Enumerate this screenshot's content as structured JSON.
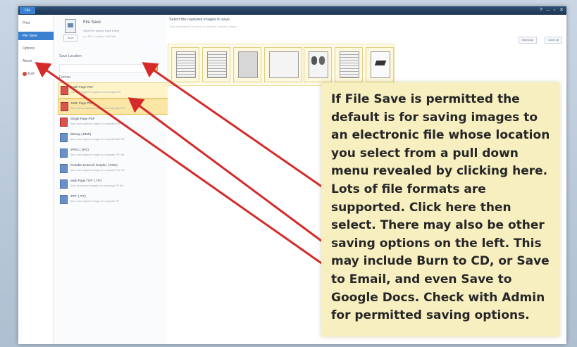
{
  "window": {
    "file_tab": "File",
    "controls": [
      "?",
      "–",
      "▫",
      "✕"
    ]
  },
  "left_nav": {
    "items": [
      {
        "label": "Print",
        "active": false
      },
      {
        "label": "File Save",
        "active": true
      },
      {
        "label": "Options",
        "active": false
      },
      {
        "label": "About",
        "active": false
      },
      {
        "label": "Exit",
        "active": false
      }
    ]
  },
  "save_panel": {
    "title": "File Save",
    "button_label": "Save",
    "subtitle": "Save Per source   Save Every",
    "subtitle2": "on: File Location: FilePath",
    "save_location_heading": "Save Location",
    "location_placeholder": "",
    "format_heading": "Format",
    "formats": [
      {
        "name": "Multi Page PDF",
        "desc": "Save all captured images to a multi page PDF",
        "icon": "pdf-icon",
        "state": "hl2"
      },
      {
        "name": "Multi Page PDF",
        "desc": "Save all the captured images to a multi page PDF",
        "icon": "pdf-icon",
        "state": "hl"
      },
      {
        "name": "Single Page PDF",
        "desc": "Save each captured image to a separate PDF",
        "icon": "pdf-icon",
        "state": ""
      },
      {
        "name": "Bitmap (.BMP)",
        "desc": "Save each captured image to a separate BMP file",
        "icon": "image-icon",
        "state": ""
      },
      {
        "name": "JPEG (.JPG)",
        "desc": "Save each captured image to a separate JPG file",
        "icon": "image-icon",
        "state": ""
      },
      {
        "name": "Portable Network Graphic (.PNG)",
        "desc": "Save each captured image to a separate PNG file",
        "icon": "image-icon",
        "state": ""
      },
      {
        "name": "Multi Page TIFF (.TIF)",
        "desc": "Save all captured images to a multi page TIF file",
        "icon": "image-icon",
        "state": ""
      },
      {
        "name": "TIFF (.TIF)",
        "desc": "Save each captured image to a separate TIF",
        "icon": "image-icon",
        "state": ""
      }
    ]
  },
  "main": {
    "title": "Select the captured images to save",
    "subtitle": "Click a thumbnail to select or deselect captured pages",
    "select_all": "Select all",
    "clear_all": "Clear all",
    "thumbnails": [
      "page-lines",
      "page-lines",
      "page-dark",
      "page-plain",
      "page-photo",
      "page-lines",
      "page-logo"
    ]
  },
  "callout": {
    "text": "If File Save is permitted the default is for saving images to an electronic file whose location you select from a pull down menu revealed by clicking here. Lots of file formats are supported. Click here then select. There may also be other saving options on the left. This may include Burn to CD, or Save to Email, and even Save to Google Docs. Check with Admin for permitted saving options."
  },
  "colors": {
    "arrow": "#d42a2a",
    "accent": "#3a7fd0",
    "callout_bg": "#f7efc0"
  }
}
